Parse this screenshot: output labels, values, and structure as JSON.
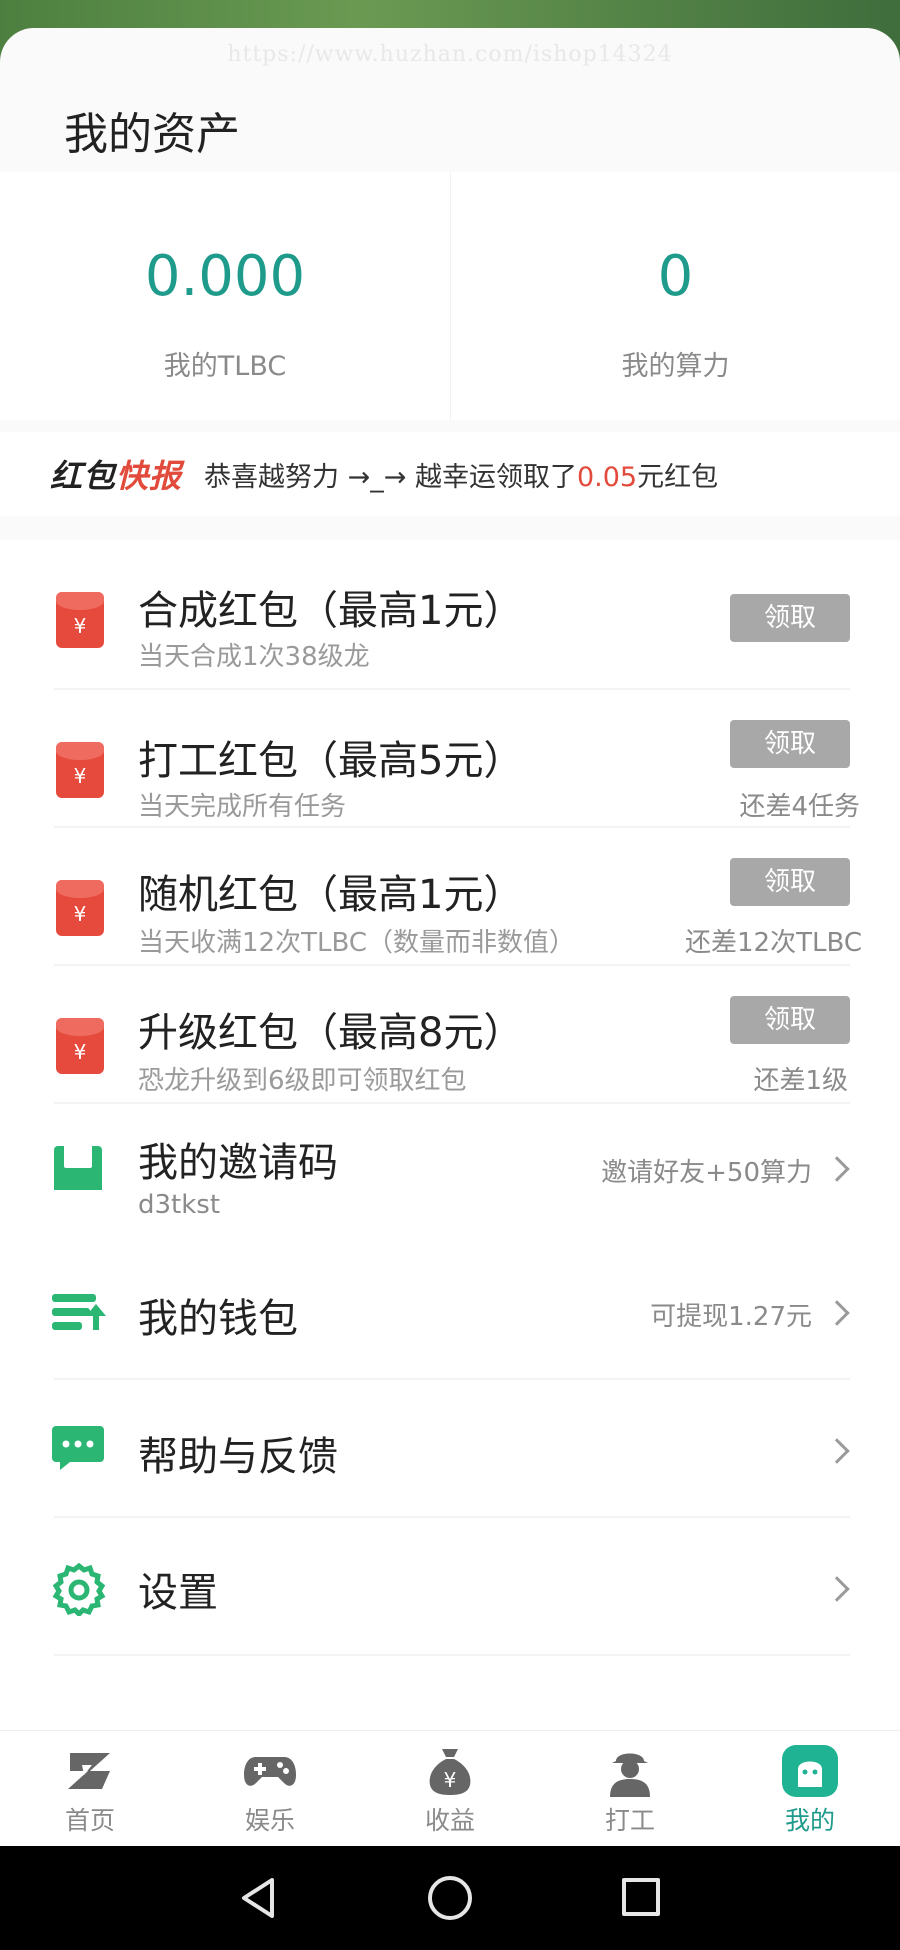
{
  "watermark": "https://www.huzhan.com/ishop14324",
  "page_title": "我的资产",
  "assets": [
    {
      "value": "0.000",
      "label": "我的TLBC"
    },
    {
      "value": "0",
      "label": "我的算力"
    }
  ],
  "news": {
    "logo_part1": "红包",
    "logo_part2": "快报",
    "text_prefix": "恭喜越努力 →_→ 越幸运领取了",
    "amount": "0.05",
    "text_suffix": "元红包"
  },
  "red_packets": [
    {
      "title": "合成红包（最高1元）",
      "subtitle": "当天合成1次38级龙",
      "button": "领取",
      "remaining": ""
    },
    {
      "title": "打工红包（最高5元）",
      "subtitle": "当天完成所有任务",
      "button": "领取",
      "remaining": "还差4任务"
    },
    {
      "title": "随机红包（最高1元）",
      "subtitle": "当天收满12次TLBC（数量而非数值）",
      "button": "领取",
      "remaining": "还差12次TLBC"
    },
    {
      "title": "升级红包（最高8元）",
      "subtitle": "恐龙升级到6级即可领取红包",
      "button": "领取",
      "remaining": "还差1级"
    }
  ],
  "menu": {
    "invite": {
      "title": "我的邀请码",
      "code": "d3tkst",
      "right": "邀请好友+50算力"
    },
    "wallet": {
      "title": "我的钱包",
      "right": "可提现1.27元"
    },
    "help": {
      "title": "帮助与反馈"
    },
    "settings": {
      "title": "设置"
    }
  },
  "yen_glyph": "¥",
  "tabs": [
    {
      "label": "首页",
      "icon": "home-z-icon"
    },
    {
      "label": "娱乐",
      "icon": "gamepad-icon"
    },
    {
      "label": "收益",
      "icon": "money-bag-icon"
    },
    {
      "label": "打工",
      "icon": "worker-icon"
    },
    {
      "label": "我的",
      "icon": "profile-icon",
      "active": true
    }
  ],
  "colors": {
    "accent": "#1f9b8c",
    "red": "#e24a3b",
    "button_gray": "#a8a8a8",
    "green_icon": "#2bb673"
  }
}
